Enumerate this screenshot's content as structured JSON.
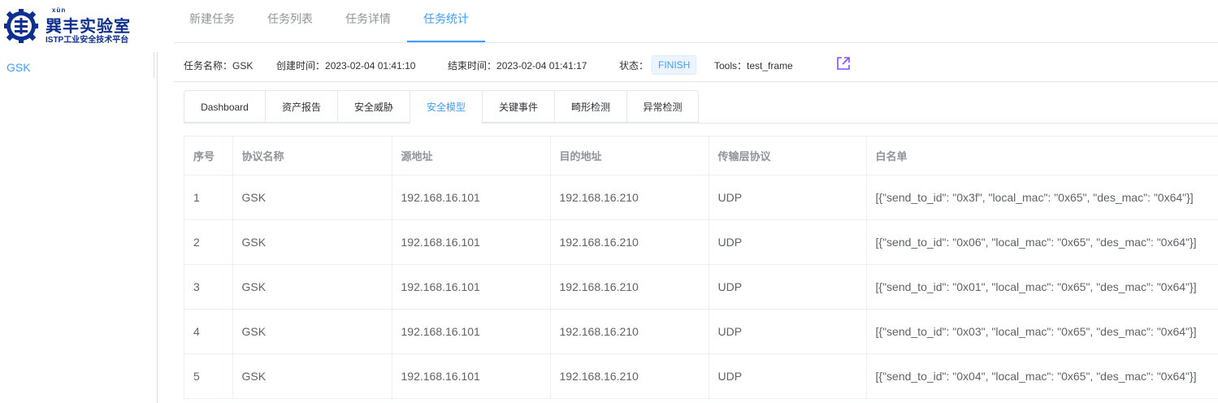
{
  "logo": {
    "pinyin": "xùn",
    "title": "巽丰实验室",
    "subtitle": "ISTP工业安全技术平台"
  },
  "topnav": {
    "items": [
      {
        "label": "新建任务"
      },
      {
        "label": "任务列表"
      },
      {
        "label": "任务详情"
      },
      {
        "label": "任务统计"
      }
    ],
    "active_index": 3
  },
  "sidebar": {
    "items": [
      {
        "label": "GSK"
      }
    ]
  },
  "info": {
    "task_name_label": "任务名称：",
    "task_name": "GSK",
    "created_label": "创建时间：",
    "created": "2023-02-04 01:41:10",
    "ended_label": "结束时间：",
    "ended": "2023-02-04 01:41:17",
    "status_label": "状态：",
    "status": "FINISH",
    "tools_label": "Tools：",
    "tools": "test_frame"
  },
  "tabs": {
    "items": [
      {
        "label": "Dashboard"
      },
      {
        "label": "资产报告"
      },
      {
        "label": "安全威胁"
      },
      {
        "label": "安全模型"
      },
      {
        "label": "关键事件"
      },
      {
        "label": "畸形检测"
      },
      {
        "label": "异常检测"
      }
    ],
    "active_index": 3
  },
  "table": {
    "headers": [
      "序号",
      "协议名称",
      "源地址",
      "目的地址",
      "传输层协议",
      "白名单"
    ],
    "rows": [
      [
        "1",
        "GSK",
        "192.168.16.101",
        "192.168.16.210",
        "UDP",
        "[{\"send_to_id\": \"0x3f\", \"local_mac\": \"0x65\", \"des_mac\": \"0x64\"}]"
      ],
      [
        "2",
        "GSK",
        "192.168.16.101",
        "192.168.16.210",
        "UDP",
        "[{\"send_to_id\": \"0x06\", \"local_mac\": \"0x65\", \"des_mac\": \"0x64\"}]"
      ],
      [
        "3",
        "GSK",
        "192.168.16.101",
        "192.168.16.210",
        "UDP",
        "[{\"send_to_id\": \"0x01\", \"local_mac\": \"0x65\", \"des_mac\": \"0x64\"}]"
      ],
      [
        "4",
        "GSK",
        "192.168.16.101",
        "192.168.16.210",
        "UDP",
        "[{\"send_to_id\": \"0x03\", \"local_mac\": \"0x65\", \"des_mac\": \"0x64\"}]"
      ],
      [
        "5",
        "GSK",
        "192.168.16.101",
        "192.168.16.210",
        "UDP",
        "[{\"send_to_id\": \"0x04\", \"local_mac\": \"0x65\", \"des_mac\": \"0x64\"}]"
      ]
    ]
  },
  "colors": {
    "primary": "#409eff",
    "brand": "#0d2f8f",
    "external_icon": "#8a4dff"
  },
  "icons": {
    "logo": "gear-emblem-icon",
    "external": "external-link-icon"
  }
}
